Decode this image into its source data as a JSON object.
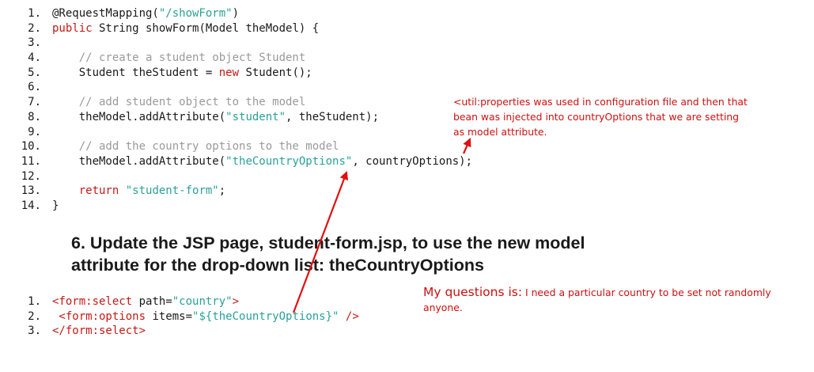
{
  "code_block_1": {
    "lines": [
      {
        "num": "1.",
        "segments": [
          {
            "t": "@RequestMapping(",
            "c": "plain"
          },
          {
            "t": "\"/showForm\"",
            "c": "string"
          },
          {
            "t": ")",
            "c": "plain"
          }
        ]
      },
      {
        "num": "2.",
        "segments": [
          {
            "t": "public",
            "c": "keyword"
          },
          {
            "t": " String showForm(Model theModel) {",
            "c": "plain"
          }
        ]
      },
      {
        "num": "3.",
        "segments": []
      },
      {
        "num": "4.",
        "segments": [
          {
            "t": "    // create a student object Student",
            "c": "comment"
          }
        ]
      },
      {
        "num": "5.",
        "segments": [
          {
            "t": "    Student theStudent = ",
            "c": "plain"
          },
          {
            "t": "new",
            "c": "keyword"
          },
          {
            "t": " Student();",
            "c": "plain"
          }
        ]
      },
      {
        "num": "6.",
        "segments": []
      },
      {
        "num": "7.",
        "segments": [
          {
            "t": "    // add student object to the model",
            "c": "comment"
          }
        ]
      },
      {
        "num": "8.",
        "segments": [
          {
            "t": "    theModel.addAttribute(",
            "c": "plain"
          },
          {
            "t": "\"student\"",
            "c": "string"
          },
          {
            "t": ", theStudent);",
            "c": "plain"
          }
        ]
      },
      {
        "num": "9.",
        "segments": []
      },
      {
        "num": "10.",
        "segments": [
          {
            "t": "    // add the country options to the model",
            "c": "comment"
          }
        ]
      },
      {
        "num": "11.",
        "segments": [
          {
            "t": "    theModel.addAttribute(",
            "c": "plain"
          },
          {
            "t": "\"theCountryOptions\"",
            "c": "string"
          },
          {
            "t": ", countryOptions);",
            "c": "plain"
          }
        ]
      },
      {
        "num": "12.",
        "segments": []
      },
      {
        "num": "13.",
        "segments": [
          {
            "t": "    ",
            "c": "plain"
          },
          {
            "t": "return",
            "c": "keyword"
          },
          {
            "t": " ",
            "c": "plain"
          },
          {
            "t": "\"student-form\"",
            "c": "string"
          },
          {
            "t": ";",
            "c": "plain"
          }
        ]
      },
      {
        "num": "14.",
        "segments": [
          {
            "t": "}",
            "c": "plain"
          }
        ]
      }
    ]
  },
  "heading": {
    "line1": "6. Update the JSP page, student-form.jsp, to use the new model",
    "line2": "attribute for the drop-down list: theCountryOptions"
  },
  "code_block_2": {
    "lines": [
      {
        "num": "1.",
        "segments": [
          {
            "t": "<form:select",
            "c": "keyword"
          },
          {
            "t": " path=",
            "c": "plain"
          },
          {
            "t": "\"country\"",
            "c": "string"
          },
          {
            "t": ">",
            "c": "keyword"
          }
        ]
      },
      {
        "num": "2.",
        "segments": [
          {
            "t": " <form:options",
            "c": "keyword"
          },
          {
            "t": " items=",
            "c": "plain"
          },
          {
            "t": "\"${theCountryOptions}\"",
            "c": "string"
          },
          {
            "t": " />",
            "c": "keyword"
          }
        ]
      },
      {
        "num": "3.",
        "segments": [
          {
            "t": "</form:select>",
            "c": "keyword"
          }
        ]
      }
    ]
  },
  "note_top": {
    "line1": "<util:properties was used in configuration file and then that",
    "line2": "bean was injected into countryOptions that we are setting",
    "line3": "as model attribute."
  },
  "note_bottom": {
    "label": "My questions is:",
    "line1_rest": " I need a particular country to be set not randomly",
    "line2": "anyone."
  },
  "colors": {
    "annotation_red": "#cc1010",
    "arrow_red": "#e01010",
    "code_string": "#2aa198",
    "code_keyword": "#c41a16",
    "code_comment": "#9a9a9a"
  }
}
